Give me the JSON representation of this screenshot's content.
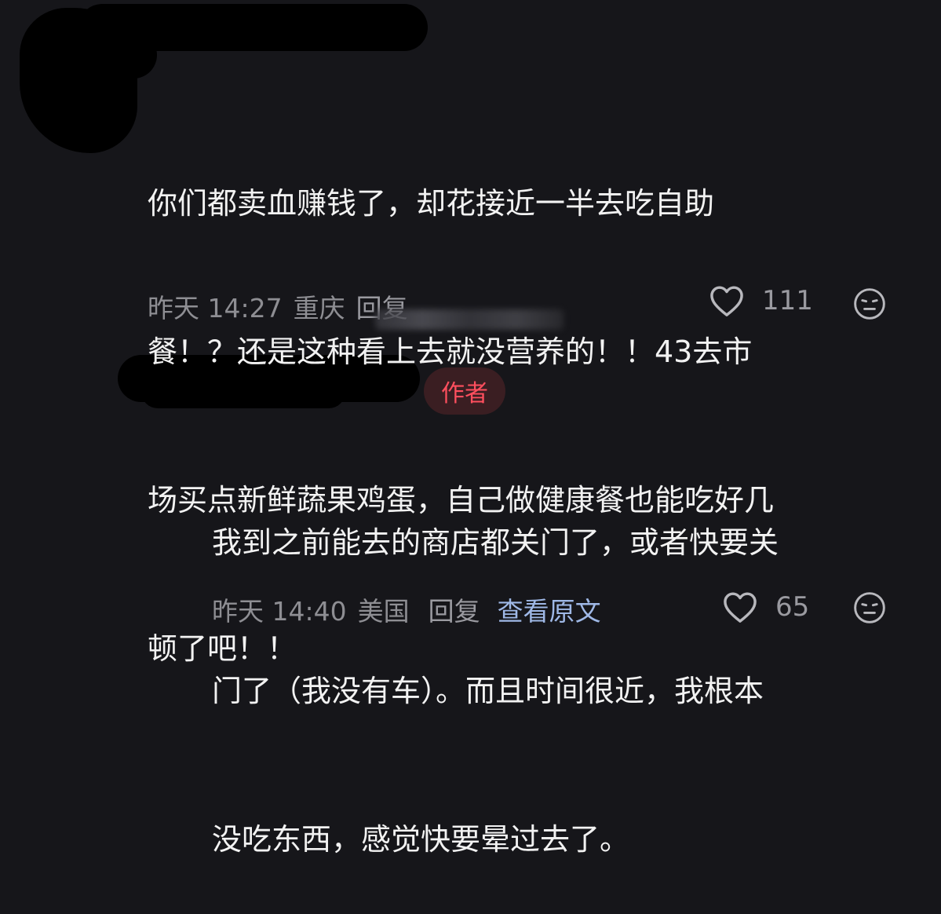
{
  "comment1": {
    "lines": [
      "你们都卖血赚钱了，却花接近一半去吃自助",
      "餐！？还是这种看上去就没营养的！！43去市",
      "场买点新鲜蔬果鸡蛋，自己做健康餐也能吃好几",
      "顿了吧！！"
    ],
    "time": "昨天 14:27",
    "location": "重庆",
    "reply_label": "回复",
    "like_count": "111"
  },
  "comment2": {
    "badge": "作者",
    "lines": [
      "我到之前能去的商店都关门了，或者快要关",
      "门了（我没有车）。而且时间很近，我根本",
      "没吃东西，感觉快要晕过去了。"
    ],
    "time": "昨天 14:40",
    "location": "美国",
    "reply_label": "回复",
    "view_original_label": "查看原文",
    "like_count": "65"
  },
  "icons": {
    "like": "heart-outline-icon",
    "emoji": "neutral-face-icon"
  },
  "colors": {
    "background": "#16161a",
    "author_badge_text": "#ff4f5e",
    "link": "#9fb8e6"
  }
}
